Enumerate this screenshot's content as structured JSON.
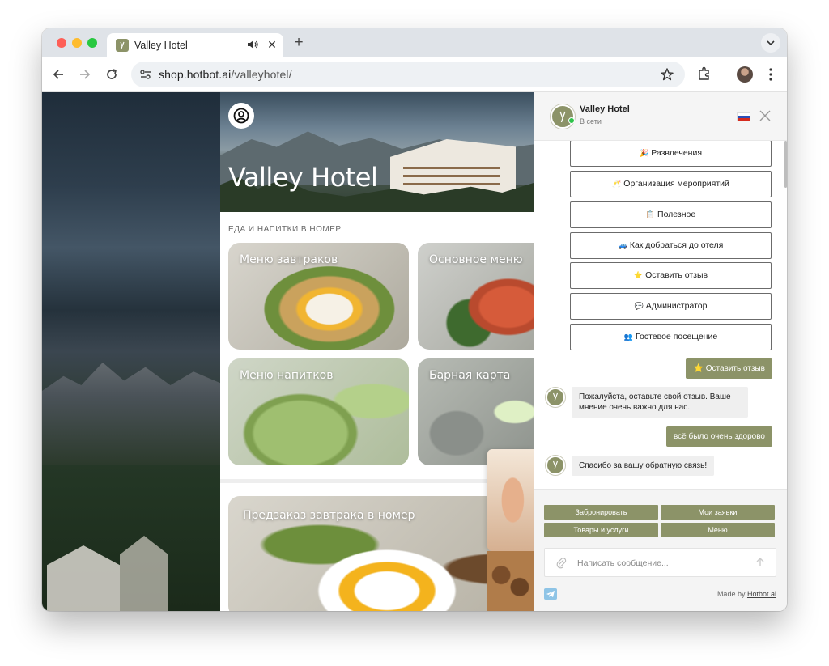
{
  "browser": {
    "tab_title": "Valley Hotel",
    "url_host": "shop.hotbot.ai",
    "url_path": "/valleyhotel/",
    "new_tab_symbol": "+",
    "close_tab_symbol": "✕",
    "tab_menu_symbol": "⌄"
  },
  "hero": {
    "title": "Valley Hotel"
  },
  "shop": {
    "section_label": "ЕДА И НАПИТКИ В НОМЕР",
    "cards": [
      {
        "title": "Меню завтраков"
      },
      {
        "title": "Основное меню"
      },
      {
        "title": "Меню напитков"
      },
      {
        "title": "Барная карта"
      },
      {
        "title": "Предзаказ завтрака в номер"
      }
    ]
  },
  "chat": {
    "name": "Valley Hotel",
    "status": "В сети",
    "language_flag": "ru",
    "quick_buttons": [
      {
        "emoji": "🎉",
        "label": "Развлечения"
      },
      {
        "emoji": "🥂",
        "label": "Организация мероприятий"
      },
      {
        "emoji": "📋",
        "label": "Полезное"
      },
      {
        "emoji": "🚙",
        "label": "Как добраться до отеля"
      },
      {
        "emoji": "⭐",
        "label": "Оставить отзыв"
      },
      {
        "emoji": "💬",
        "label": "Администратор"
      },
      {
        "emoji": "👥",
        "label": "Гостевое посещение"
      }
    ],
    "messages": [
      {
        "from": "user",
        "text": "⭐ Оставить отзыв"
      },
      {
        "from": "bot",
        "text": "Пожалуйста, оставьте свой отзыв. Ваше мнение очень важно для нас."
      },
      {
        "from": "user",
        "text": "всё было очень здорово"
      },
      {
        "from": "bot",
        "text": "Спасибо за вашу обратную связь!"
      }
    ],
    "footer_buttons": [
      "Забронировать",
      "Мои заявки",
      "Товары и услуги",
      "Меню"
    ],
    "input_placeholder": "Написать сообщение...",
    "made_by_prefix": "Made by ",
    "made_by_link": "Hotbot.ai"
  },
  "colors": {
    "accent": "#8c9368",
    "online": "#2ec24a"
  }
}
